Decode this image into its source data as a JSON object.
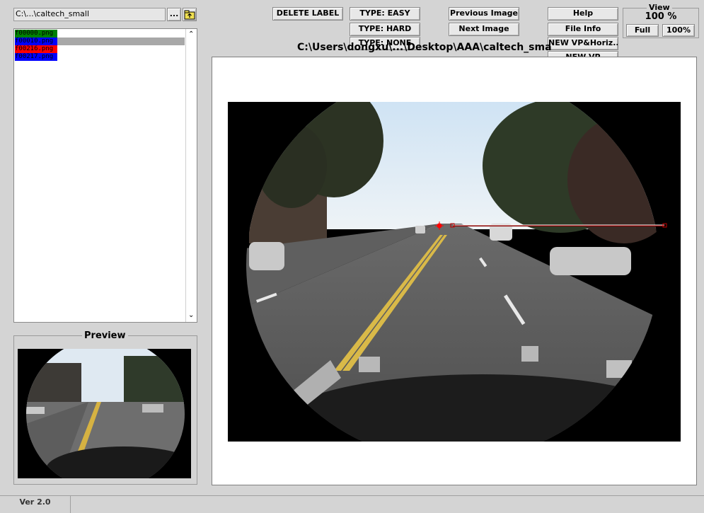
{
  "toolbar": {
    "path_value": "C:\\...\\caltech_small",
    "browse_label": "...",
    "folder_up_icon": "folder-up-icon",
    "delete_label": "DELETE LABEL",
    "type_easy": "TYPE: EASY",
    "type_hard": "TYPE: HARD",
    "type_none": "TYPE: NONE",
    "prev_image": "Previous Image",
    "next_image": "Next Image",
    "help": "Help",
    "file_info": "File Info",
    "new_vp_horiz": "NEW VP&Horiz...",
    "new_vp": "NEW VP"
  },
  "view": {
    "title": "View",
    "zoom": "100 %",
    "full": "Full",
    "hundred": "100%"
  },
  "file_list": {
    "items": [
      {
        "name": "f00000.png",
        "bg": "#008000",
        "fg": "#000000"
      },
      {
        "name": "f00010.png",
        "bg": "#0000ff",
        "fg": "#000000"
      },
      {
        "name": "f00216.png",
        "bg": "#ff0000",
        "fg": "#000000"
      },
      {
        "name": "f00217.png",
        "bg": "#0000ff",
        "fg": "#000000"
      }
    ],
    "selected_index": 1
  },
  "preview": {
    "title": "Preview"
  },
  "main": {
    "image_path": "C:\\Users\\dongxu\\...\\Desktop\\AAA\\caltech_small"
  },
  "status": {
    "version": "Ver 2.0"
  },
  "colors": {
    "annotation_line": "#c00000",
    "vanishing_point": "#ff0000"
  }
}
